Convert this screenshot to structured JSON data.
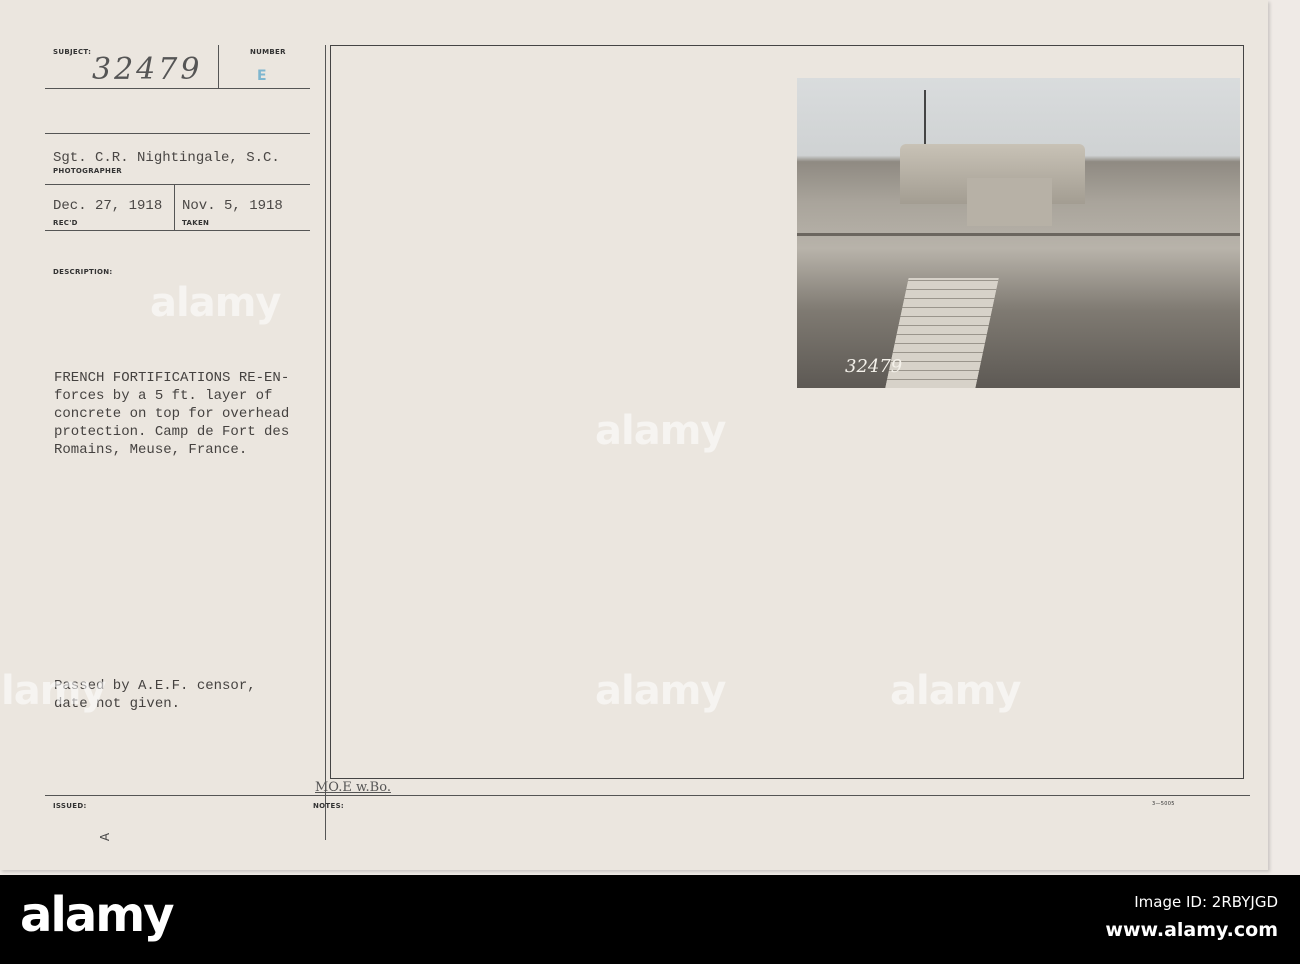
{
  "card": {
    "subject_label": "SUBJECT:",
    "subject_value": "32479",
    "number_label": "NUMBER",
    "number_value": "E",
    "photographer": "Sgt. C.R. Nightingale, S.C.",
    "photographer_label": "PHOTOGRAPHER",
    "received": "Dec. 27, 1918",
    "received_label": "REC'D",
    "taken": "Nov. 5, 1918",
    "taken_label": "TAKEN",
    "description_label": "DESCRIPTION:",
    "description": "FRENCH FORTIFICATIONS RE-EN-\nforces by a 5 ft. layer of\nconcrete on top for overhead\nprotection. Camp de Fort des\nRomains, Meuse, France.",
    "censor": "Passed by A.E.F. censor,\ndate not given.",
    "issued_label": "ISSUED:",
    "issued_mark": "A",
    "notes_label": "NOTES:",
    "notes_handwritten": "MO.E w.Bo.",
    "form_number": "3—5005",
    "photo_number": "32479"
  },
  "watermark": "alamy",
  "footer": {
    "logo": "alamy",
    "image_id": "Image ID: 2RBYJGD",
    "site": "www.alamy.com"
  }
}
